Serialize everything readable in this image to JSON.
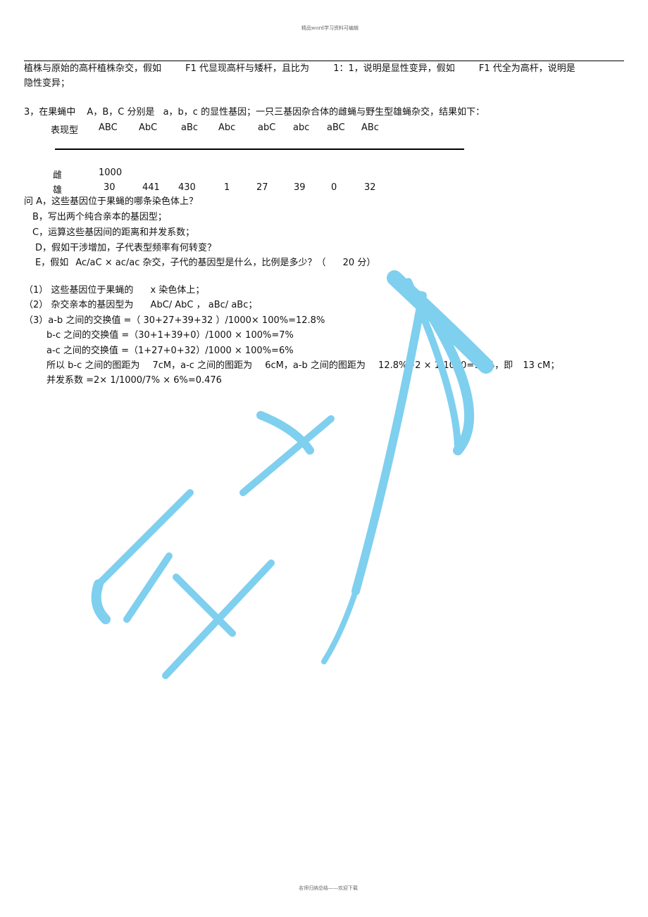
{
  "header": "精品word学习资料可编辑",
  "footer": "名师归纳总结——欢迎下载",
  "intro": {
    "line1": [
      "植株与原始的高杆植株杂交，假如",
      "F1 代显现高杆与矮杆，且比为",
      "1：1，说明是显性变异，假如",
      "F1 代全为高杆，说明是"
    ],
    "line2": "隐性变异；"
  },
  "question3": {
    "stem": [
      "3，在果蝇中",
      "A，B，C 分别是",
      "a，b，c 的显性基因；一只三基因杂合体的雌蝇与野生型雄蝇杂交，结果如下："
    ],
    "table": {
      "row_label": "表现型",
      "phenotypes": [
        "ABC",
        "AbC",
        "aBc",
        "Abc",
        "abC",
        "abc",
        "aBC",
        "ABc"
      ],
      "female_label": "雌",
      "female_values": [
        "1000"
      ],
      "male_label": "雄",
      "male_values": [
        "30",
        "441",
        "430",
        "1",
        "27",
        "39",
        "0",
        "32"
      ]
    },
    "questions": [
      "问 A，这些基因位于果蝇的哪条染色体上？",
      "B，写出两个纯合亲本的基因型；",
      "C，运算这些基因间的距离和并发系数；",
      "D，假如干涉增加，子代表型频率有何转变？",
      [
        "E，假如",
        "Ac/aC × ac/ac 杂交，子代的基因型是什么，比例是多少？（",
        "20 分）"
      ]
    ]
  },
  "answers": [
    [
      "（1） 这些基因位于果蝇的",
      "x 染色体上；"
    ],
    [
      "（2） 杂交亲本的基因型为",
      "AbC/ AbC ， aBc/ aBc；"
    ],
    [
      "（3）a-b 之间的交换值 =（ 30+27+39+32 ）/1000× 100%=12.8%"
    ],
    [
      "b-c 之间的交换值 =（30+1+39+0）/1000 × 100%=7%"
    ],
    [
      "a-c  之间的交换值 =（1+27+0+32）/1000 × 100%=6%"
    ],
    [
      "所以  b-c  之间的图距为",
      "7cM，a-c  之间的图距为",
      "6cM，a-b 之间的图距为",
      "12.8%+2 × 1/1000=13%，即",
      "13 cM；"
    ],
    [
      "并发系数  =2× 1/1000/7% × 6%=0.476"
    ]
  ],
  "watermark_color": "#7fcfef"
}
